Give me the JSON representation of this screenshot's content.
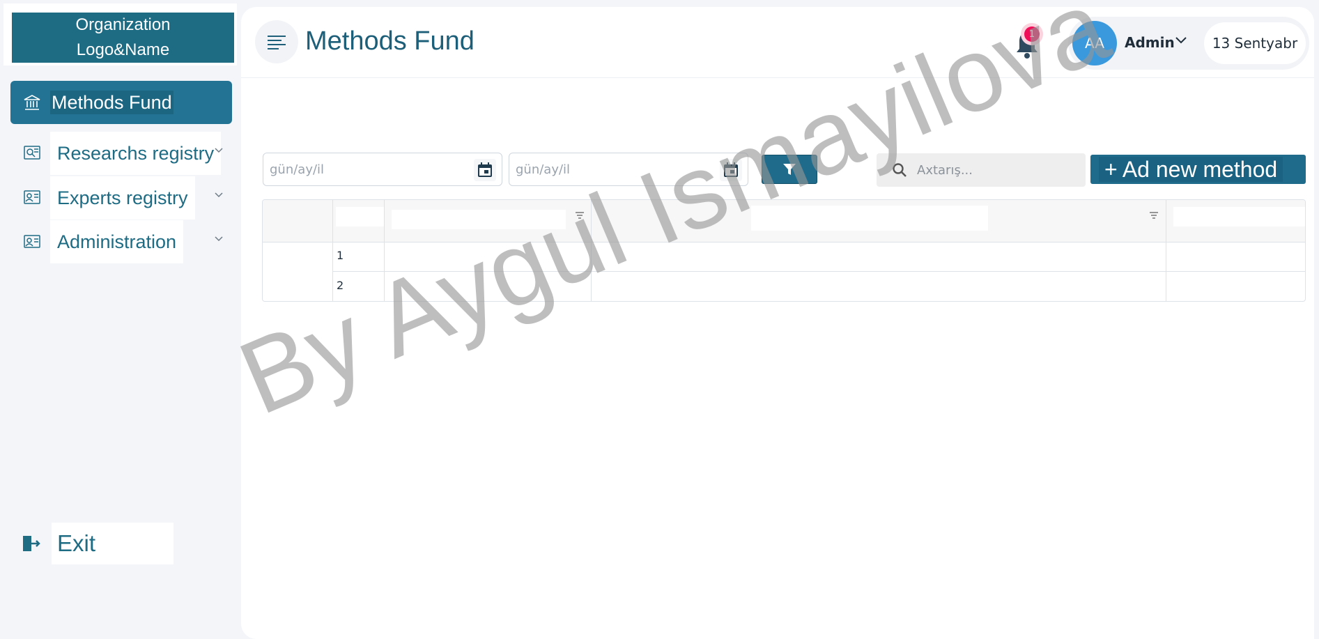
{
  "sidebar": {
    "logo_text": "Organization\nLogo&Name",
    "items": [
      {
        "label": "Methods Fund",
        "icon": "bank-icon"
      },
      {
        "label": "Researchs registry",
        "icon": "research-icon"
      },
      {
        "label": "Experts registry",
        "icon": "experts-icon"
      },
      {
        "label": "Administration",
        "icon": "admin-icon"
      }
    ],
    "exit_label": "Exit"
  },
  "header": {
    "title": "Methods Fund",
    "notification_count": "1",
    "avatar_initials": "AA",
    "user_name": "Admin",
    "date": "13 Sentyabr"
  },
  "toolbar": {
    "date_from_placeholder": "gün/ay/il",
    "date_to_placeholder": "gün/ay/il",
    "search_placeholder": "Axtarış...",
    "add_button_label": "+ Ad new method"
  },
  "table": {
    "rows": [
      "1",
      "2"
    ]
  },
  "watermark": "By Aygul Ismayilova",
  "colors": {
    "primary": "#1e6b8c",
    "accent_blue": "#3a99dd",
    "badge": "#f10e59"
  }
}
